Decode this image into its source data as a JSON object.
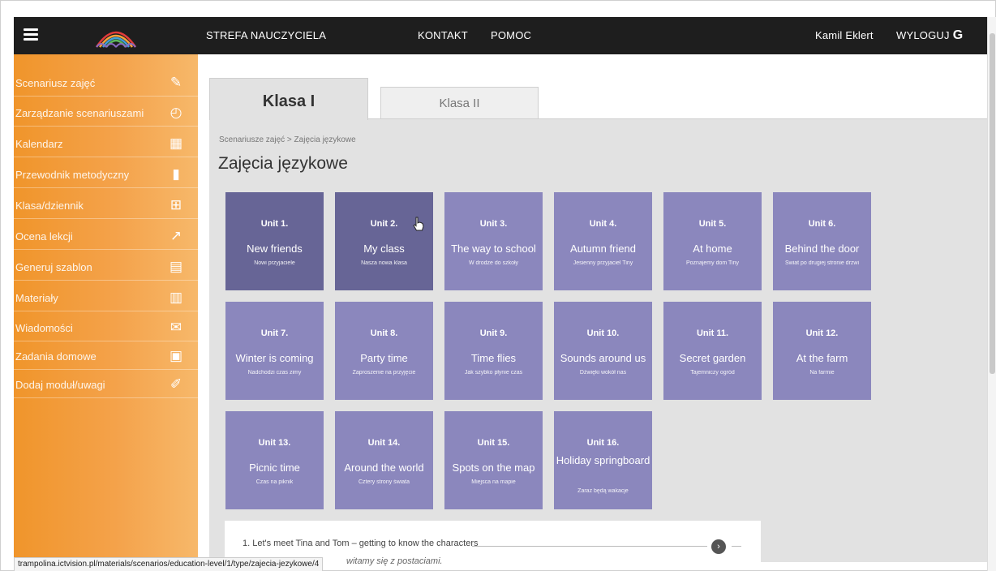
{
  "header": {
    "teacher_zone": "STREFA NAUCZYCIELA",
    "contact": "KONTAKT",
    "help": "POMOC",
    "user_name": "Kamil Eklert",
    "logout": "WYLOGUJ"
  },
  "sidebar": {
    "items": [
      {
        "label": "Scenariusz zajęć",
        "icon": "edit-icon"
      },
      {
        "label": "Zarządzanie scenariuszami",
        "icon": "compass-icon"
      },
      {
        "label": "Kalendarz",
        "icon": "calendar-icon"
      },
      {
        "label": "Przewodnik metodyczny",
        "icon": "book-icon"
      },
      {
        "label": "Klasa/dziennik",
        "icon": "classroom-icon"
      },
      {
        "label": "Ocena lekcji",
        "icon": "chart-icon"
      },
      {
        "label": "Generuj szablon",
        "icon": "template-icon"
      },
      {
        "label": "Materiały",
        "icon": "film-icon"
      },
      {
        "label": "Wiadomości",
        "icon": "envelope-icon"
      },
      {
        "label": "Zadania domowe",
        "icon": "homework-icon"
      },
      {
        "label": "Dodaj moduł/uwagi",
        "icon": "add-note-icon"
      }
    ]
  },
  "tabs": {
    "active": "Klasa I",
    "inactive": "Klasa II"
  },
  "breadcrumb": "Scenariusze zajęć  >  Zajęcia językowe",
  "page_title": "Zajęcia językowe",
  "units": [
    {
      "unit": "Unit 1.",
      "title": "New friends",
      "subtitle": "Nowi przyjaciele"
    },
    {
      "unit": "Unit 2.",
      "title": "My class",
      "subtitle": "Nasza nowa klasa"
    },
    {
      "unit": "Unit 3.",
      "title": "The way to school",
      "subtitle": "W drodze do szkoły"
    },
    {
      "unit": "Unit 4.",
      "title": "Autumn friend",
      "subtitle": "Jesienny przyjaciel Tiny"
    },
    {
      "unit": "Unit 5.",
      "title": "At home",
      "subtitle": "Poznajemy dom Tiny"
    },
    {
      "unit": "Unit 6.",
      "title": "Behind the door",
      "subtitle": "Świat po drugiej stronie drzwi"
    },
    {
      "unit": "Unit 7.",
      "title": "Winter is coming",
      "subtitle": "Nadchodzi czas zimy"
    },
    {
      "unit": "Unit 8.",
      "title": "Party time",
      "subtitle": "Zaproszenie na przyjęcie"
    },
    {
      "unit": "Unit 9.",
      "title": "Time flies",
      "subtitle": "Jak szybko płynie czas"
    },
    {
      "unit": "Unit 10.",
      "title": "Sounds around us",
      "subtitle": "Dźwięki wokół nas"
    },
    {
      "unit": "Unit 11.",
      "title": "Secret garden",
      "subtitle": "Tajemniczy ogród"
    },
    {
      "unit": "Unit 12.",
      "title": "At the farm",
      "subtitle": "Na farmie"
    },
    {
      "unit": "Unit 13.",
      "title": "Picnic time",
      "subtitle": "Czas na piknik"
    },
    {
      "unit": "Unit 14.",
      "title": "Around the world",
      "subtitle": "Cztery strony świata"
    },
    {
      "unit": "Unit 15.",
      "title": "Spots on the map",
      "subtitle": "Miejsca na mapie"
    },
    {
      "unit": "Unit 16.",
      "title": "Holiday springboard",
      "subtitle": "Zaraz będą wakacje"
    }
  ],
  "lesson": {
    "title": "1. Let's meet Tina and Tom – getting to know the characters",
    "subtitle": "witamy się z postaciami."
  },
  "status_url": "trampolina.ictvision.pl/materials/scenarios/education-level/1/type/zajecia-jezykowe/4",
  "colors": {
    "topbar": "#1e1e1e",
    "sidebar": "#f39c36",
    "tile": "#8b87bd",
    "tile_dark": "#676596",
    "panel": "#e2e2e2"
  }
}
